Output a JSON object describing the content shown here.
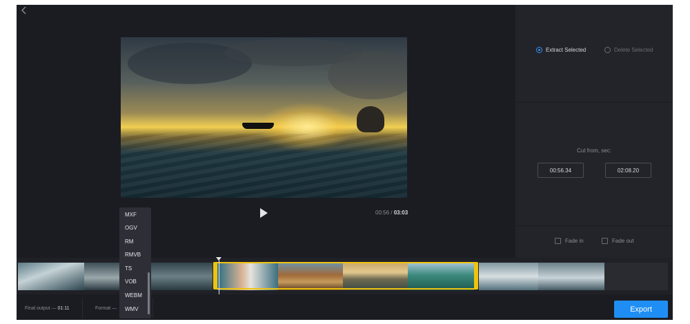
{
  "options": {
    "extract_label": "Extract Selected",
    "delete_label": "Delete Selected",
    "cut_label": "Cut from, sec:",
    "from_value": "00:56.34",
    "to_label": "to",
    "to_value": "02:08.20",
    "fade_in_label": "Fade in",
    "fade_out_label": "Fade out",
    "selected_mode": "extract"
  },
  "player": {
    "current_time": "00:56",
    "separator": "/",
    "total_time": "03:03"
  },
  "footer": {
    "final_output_label": "Final output —",
    "final_output_value": "01:11",
    "format_label": "Format —",
    "export_label": "Export"
  },
  "format_dropdown": {
    "items": [
      "MXF",
      "OGV",
      "RM",
      "RMVB",
      "TS",
      "VOB",
      "WEBM",
      "WMV"
    ]
  },
  "colors": {
    "accent": "#1f8ef4",
    "selection": "#f0c40e",
    "background": "#1b1c21",
    "panel": "#23242a"
  },
  "icons": {
    "back": "chevron-left-icon",
    "play": "play-icon"
  }
}
